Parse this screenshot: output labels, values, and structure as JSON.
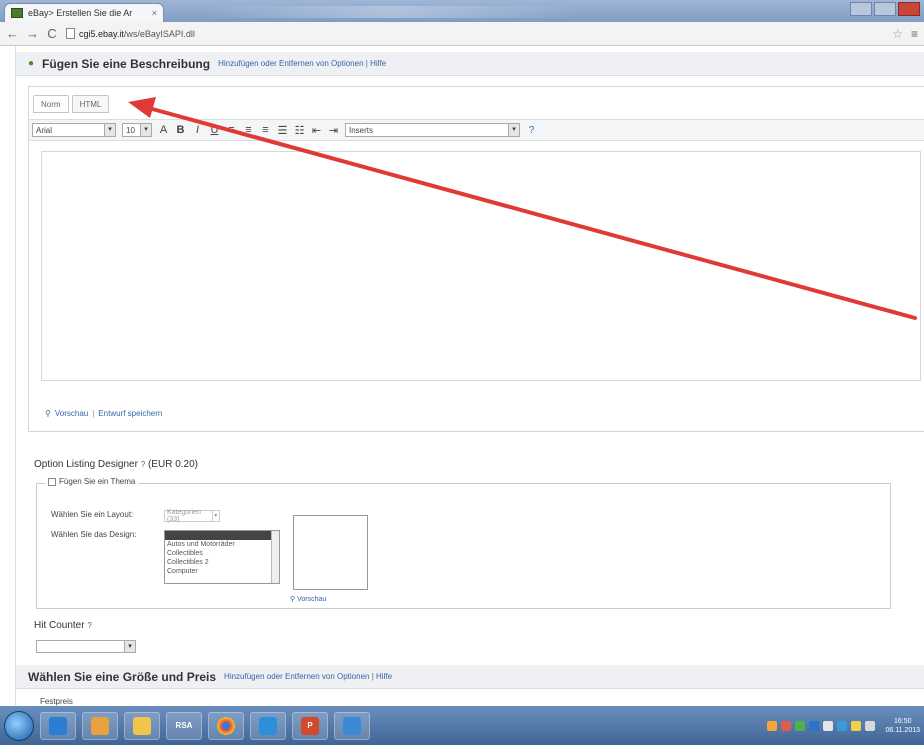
{
  "browser": {
    "tab_title": "eBay> Erstellen Sie die Ar",
    "tab_close": "×",
    "url_prefix": "cgi5.ebay.it",
    "url_rest": "/ws/eBayISAPI.dll"
  },
  "description": {
    "title": "Fügen Sie eine Beschreibung",
    "links": {
      "options": "Hinzufügen oder Entfernen von Optionen",
      "sep": "|",
      "help": "Hilfe"
    },
    "tabs": [
      "Norm",
      "HTML"
    ],
    "toolbar": {
      "font": "Arial",
      "size": "10",
      "inserts": "Inserts"
    },
    "footer": {
      "preview": "Vorschau",
      "sep": "|",
      "save": "Entwurf speichern"
    }
  },
  "listing_designer": {
    "title": "Option Listing Designer",
    "price": "(EUR 0.20)",
    "theme_label": "Fügen Sie ein Thema",
    "layout_label": "Wählen Sie ein Layout:",
    "layout_value": "Kategorien (33)",
    "design_label": "Wählen Sie das Design:",
    "design_options": [
      "",
      "Autos und Motorräder",
      "Collectibles",
      "Collectibles 2",
      "Computer"
    ],
    "preview_link": "Vorschau"
  },
  "hit_counter": {
    "label": "Hit Counter"
  },
  "size_price": {
    "title": "Wählen Sie eine Größe und Preis",
    "links": {
      "options": "Hinzufügen oder Entfernen von Optionen",
      "sep": "|",
      "help": "Hilfe"
    },
    "sub_label": "Festpreis"
  },
  "taskbar": {
    "apps": [
      "",
      "",
      "",
      "",
      "RSA",
      "",
      "",
      "P",
      ""
    ],
    "clock_time": "16:50",
    "clock_date": "06.11.2013"
  },
  "annotation": {
    "color": "#e03a36"
  },
  "colors": {
    "link": "#3366aa",
    "accent": "#4a8a2a"
  }
}
